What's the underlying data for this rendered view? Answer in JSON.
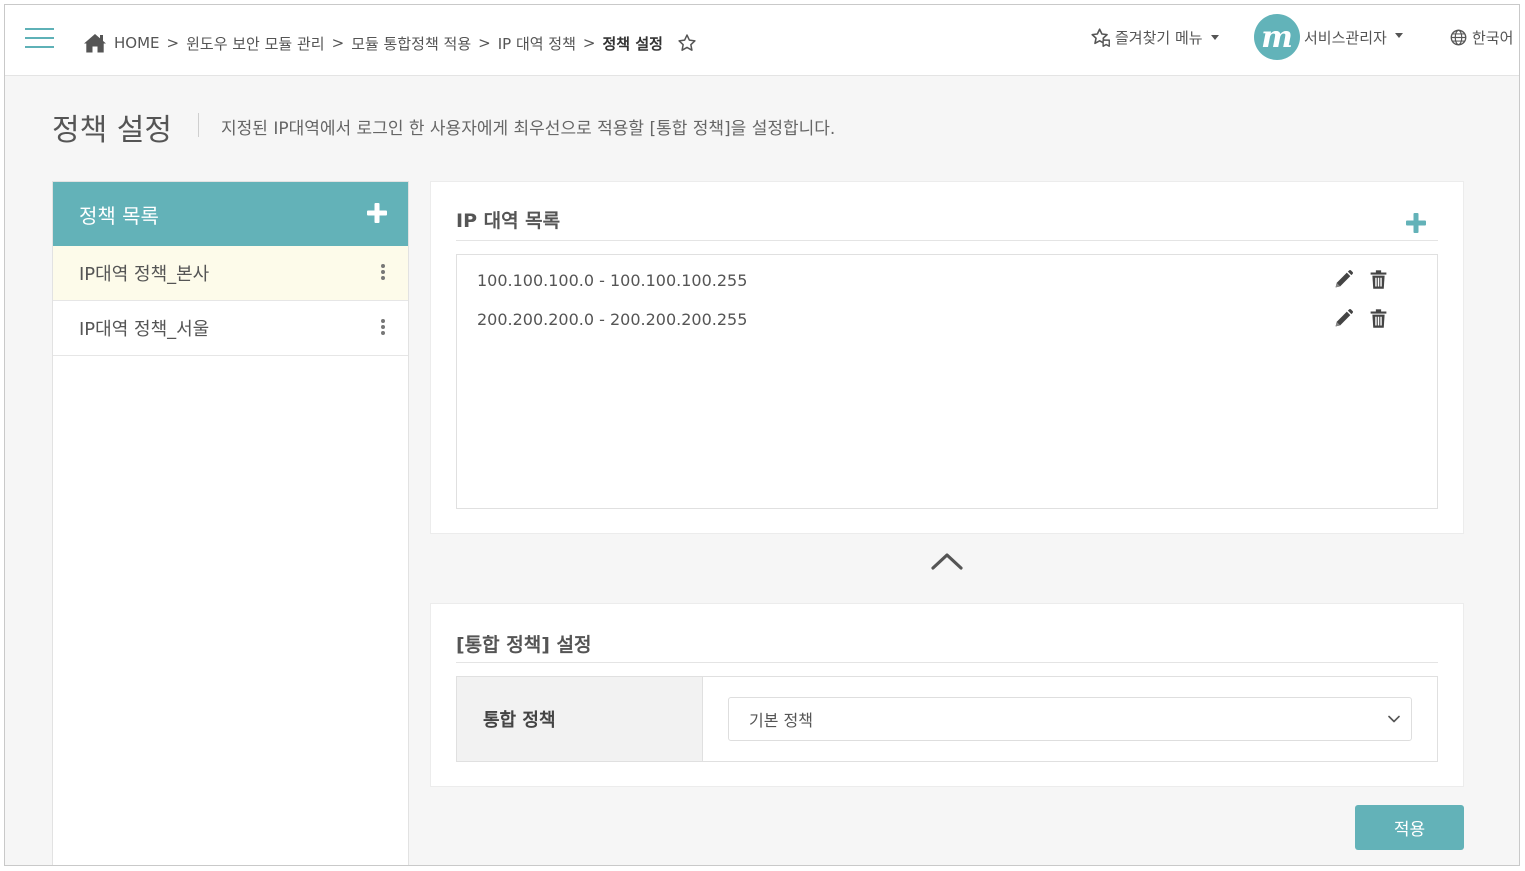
{
  "header": {
    "breadcrumb": [
      "HOME",
      "윈도우 보안 모듈 관리",
      "모듈 통합정책 적용",
      "IP 대역 정책",
      "정책 설정"
    ],
    "separator": ">",
    "favorites_label": "즐겨찾기 메뉴",
    "user": {
      "avatar_letter": "m",
      "name": "서비스관리자"
    },
    "language": "한국어",
    "icons": [
      "menu-icon",
      "home-icon",
      "star-icon",
      "star-tag-icon",
      "globe-icon"
    ]
  },
  "page": {
    "title": "정책 설정",
    "description": "지정된 IP대역에서 로그인 한 사용자에게 최우선으로 적용할 [통합 정책]을 설정합니다."
  },
  "policy_list": {
    "title": "정책 목록",
    "items": [
      {
        "label": "IP대역 정책_본사",
        "selected": true
      },
      {
        "label": "IP대역 정책_서울",
        "selected": false
      }
    ]
  },
  "ip_ranges": {
    "title": "IP 대역 목록",
    "rows": [
      {
        "range": "100.100.100.0 - 100.100.100.255"
      },
      {
        "range": "200.200.200.0 - 200.200.200.255"
      }
    ]
  },
  "policy_settings": {
    "title": "[통합 정책] 설정",
    "field_label": "통합 정책",
    "selected_value": "기본 정책"
  },
  "apply_button": "적용",
  "colors": {
    "accent": "#63b2b8",
    "selected_row": "#fdfbea",
    "label_bg": "#f2f2f2"
  }
}
